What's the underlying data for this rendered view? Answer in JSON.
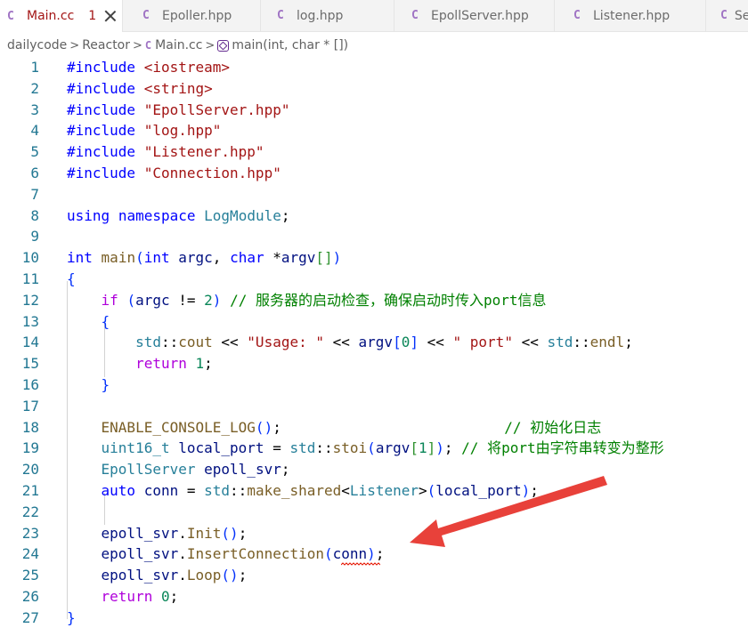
{
  "tabs": [
    {
      "icon": "C",
      "label": "Main.cc",
      "badge": "1",
      "active": true
    },
    {
      "icon": "C",
      "label": "Epoller.hpp"
    },
    {
      "icon": "C",
      "label": "log.hpp"
    },
    {
      "icon": "C",
      "label": "EpollServer.hpp"
    },
    {
      "icon": "C",
      "label": "Listener.hpp"
    },
    {
      "icon": "C",
      "label": "Se"
    }
  ],
  "breadcrumb": {
    "folder1": "dailycode",
    "folder2": "Reactor",
    "file_icon": "C",
    "file": "Main.cc",
    "function": "main(int, char * [])",
    "sep": ">"
  },
  "code_lines": [
    {
      "n": "1",
      "text": "#include <iostream>"
    },
    {
      "n": "2",
      "text": "#include <string>"
    },
    {
      "n": "3",
      "text": "#include \"EpollServer.hpp\""
    },
    {
      "n": "4",
      "text": "#include \"log.hpp\""
    },
    {
      "n": "5",
      "text": "#include \"Listener.hpp\""
    },
    {
      "n": "6",
      "text": "#include \"Connection.hpp\""
    },
    {
      "n": "7",
      "text": ""
    },
    {
      "n": "8",
      "text": "using namespace LogModule;"
    },
    {
      "n": "9",
      "text": ""
    },
    {
      "n": "10",
      "text": "int main(int argc, char *argv[])"
    },
    {
      "n": "11",
      "text": "{"
    },
    {
      "n": "12",
      "text": "    if (argc != 2) // 服务器的启动检查，确保启动时传入port信息"
    },
    {
      "n": "13",
      "text": "    {"
    },
    {
      "n": "14",
      "text": "        std::cout << \"Usage: \" << argv[0] << \" port\" << std::endl;"
    },
    {
      "n": "15",
      "text": "        return 1;"
    },
    {
      "n": "16",
      "text": "    }"
    },
    {
      "n": "17",
      "text": ""
    },
    {
      "n": "18",
      "text": "    ENABLE_CONSOLE_LOG();                          // 初始化日志"
    },
    {
      "n": "19",
      "text": "    uint16_t local_port = std::stoi(argv[1]); // 将port由字符串转变为整形"
    },
    {
      "n": "20",
      "text": "    EpollServer epoll_svr;"
    },
    {
      "n": "21",
      "text": "    auto conn = std::make_shared<Listener>(local_port);"
    },
    {
      "n": "22",
      "text": ""
    },
    {
      "n": "23",
      "text": "    epoll_svr.Init();"
    },
    {
      "n": "24",
      "text": "    epoll_svr.InsertConnection(conn);"
    },
    {
      "n": "25",
      "text": "    epoll_svr.Loop();"
    },
    {
      "n": "26",
      "text": "    return 0;"
    },
    {
      "n": "27",
      "text": "}"
    }
  ],
  "colors": {
    "accent_arrow": "#e8413a",
    "keyword": "#0000ff",
    "string": "#a31515",
    "comment": "#008000",
    "function": "#795e26",
    "type": "#267f99",
    "line_number": "#237893"
  },
  "icons": {
    "file_icon": "cpp-file-icon",
    "close_icon": "close-icon",
    "function_icon": "function-symbol-icon"
  }
}
